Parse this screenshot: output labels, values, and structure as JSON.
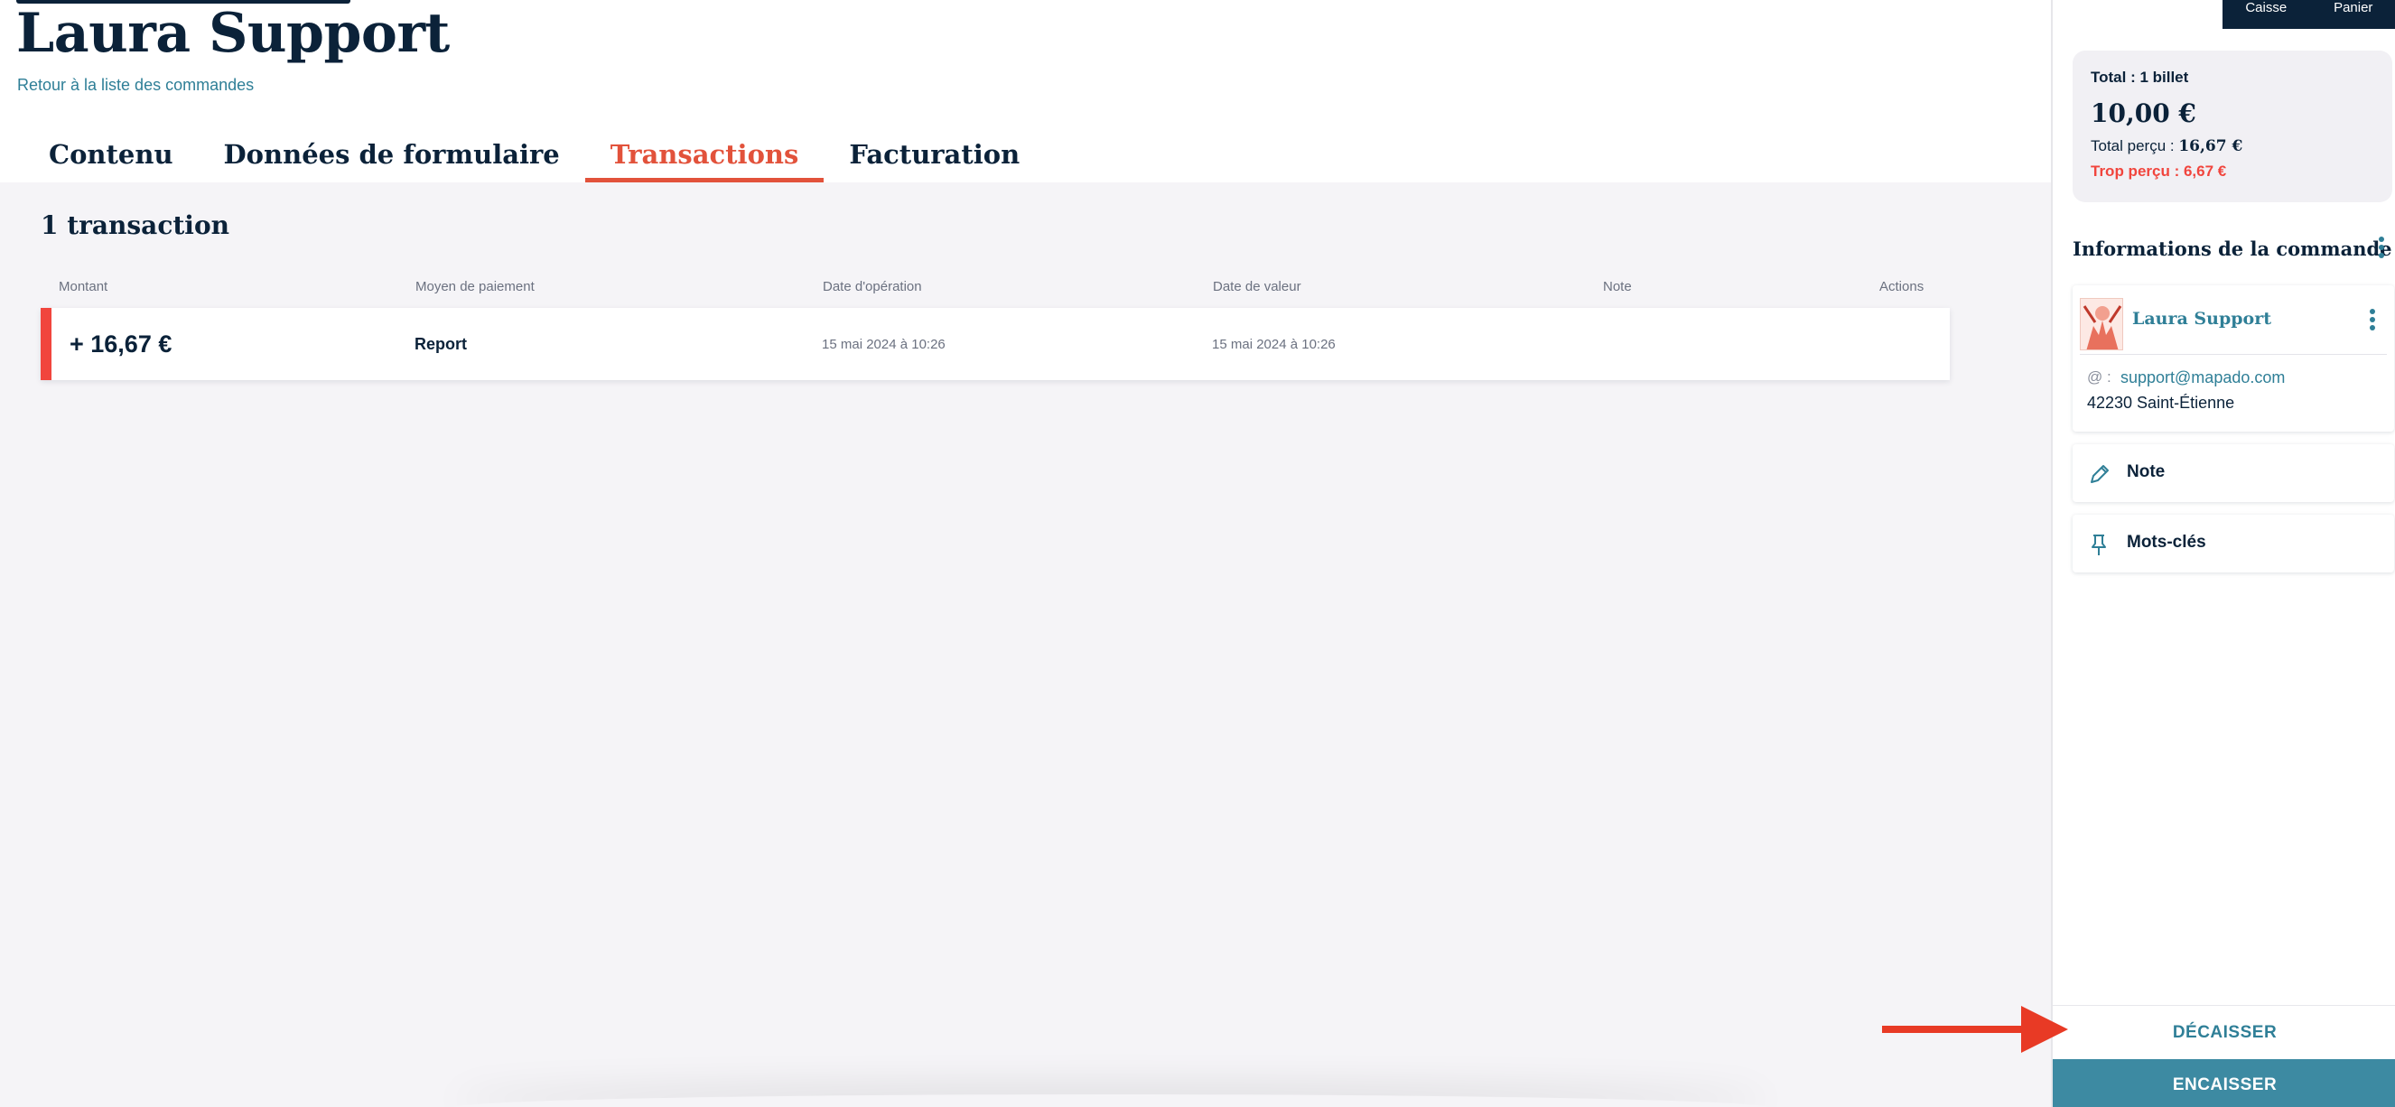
{
  "header": {
    "title": "Laura Support",
    "back_link": "Retour à la liste des commandes"
  },
  "tabs": [
    {
      "label": "Contenu",
      "active": false
    },
    {
      "label": "Données de formulaire",
      "active": false
    },
    {
      "label": "Transactions",
      "active": true
    },
    {
      "label": "Facturation",
      "active": false
    }
  ],
  "transactions": {
    "count_label": "1 transaction",
    "columns": {
      "amount": "Montant",
      "method": "Moyen de paiement",
      "operation_date": "Date d'opération",
      "value_date": "Date de valeur",
      "note": "Note",
      "actions": "Actions"
    },
    "rows": [
      {
        "amount": "+ 16,67 €",
        "method": "Report",
        "operation_date": "15 mai 2024 à 10:26",
        "value_date": "15 mai 2024 à 10:26",
        "note": "",
        "status_color": "#f1453d"
      }
    ]
  },
  "sidebar": {
    "top_buttons": {
      "caisse": "Caisse",
      "panier": "Panier"
    },
    "totals": {
      "label": "Total : 1 billet",
      "amount": "10,00 €",
      "received_label": "Total perçu : ",
      "received_value": "16,67 €",
      "overpaid": "Trop perçu : 6,67 €"
    },
    "order_info_title": "Informations de la commande",
    "customer": {
      "name": "Laura Support",
      "email_prefix": "@ :",
      "email": "support@mapado.com",
      "city": "42230 Saint-Étienne"
    },
    "items": [
      {
        "label": "Note",
        "icon": "pencil-icon"
      },
      {
        "label": "Mots-clés",
        "icon": "pin-icon"
      }
    ],
    "decaisser_label": "DÉCAISSER",
    "encaisser_label": "ENCAISSER"
  },
  "colors": {
    "accent": "#e2523b",
    "link": "#2f7f97",
    "navy": "#0b2239",
    "primary_button": "#3d8aa2",
    "annotation_arrow": "#e83a25"
  }
}
